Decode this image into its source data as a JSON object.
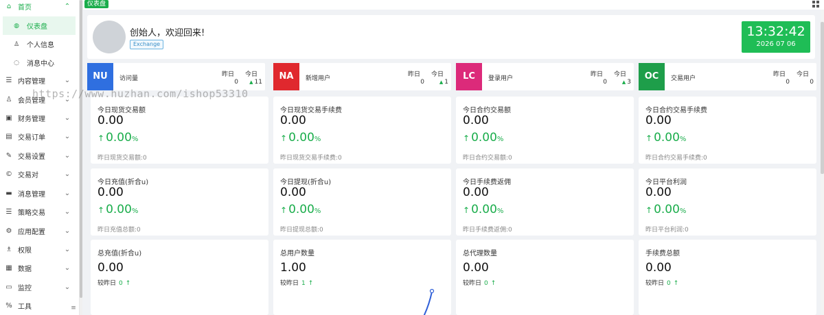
{
  "sidebar": {
    "items": [
      {
        "label": "首页",
        "icon": "home-icon",
        "glyph": "⌂",
        "chev": "⌃"
      },
      {
        "label": "内容管理",
        "icon": "list-icon",
        "glyph": "☰",
        "chev": "⌄"
      },
      {
        "label": "会员管理",
        "icon": "user-icon",
        "glyph": "♙",
        "chev": "⌄"
      },
      {
        "label": "财务管理",
        "icon": "finance-icon",
        "glyph": "▣",
        "chev": "⌄"
      },
      {
        "label": "交易订单",
        "icon": "order-icon",
        "glyph": "▤",
        "chev": "⌄"
      },
      {
        "label": "交易设置",
        "icon": "tool-icon",
        "glyph": "✎",
        "chev": "⌄"
      },
      {
        "label": "交易对",
        "icon": "copyright-icon",
        "glyph": "©",
        "chev": "⌄"
      },
      {
        "label": "消息管理",
        "icon": "message-icon",
        "glyph": "▬",
        "chev": "⌄"
      },
      {
        "label": "策略交易",
        "icon": "menu-icon",
        "glyph": "☰",
        "chev": "⌄"
      },
      {
        "label": "应用配置",
        "icon": "app-icon",
        "glyph": "⚙",
        "chev": "⌄"
      },
      {
        "label": "权限",
        "icon": "permission-icon",
        "glyph": "♗",
        "chev": "⌄"
      },
      {
        "label": "数据",
        "icon": "data-icon",
        "glyph": "▦",
        "chev": "⌄"
      },
      {
        "label": "监控",
        "icon": "monitor-icon",
        "glyph": "▭",
        "chev": "⌄"
      },
      {
        "label": "工具",
        "icon": "tools-icon",
        "glyph": "%",
        "chev": "⌄"
      }
    ],
    "sub_items": [
      {
        "label": "仪表盘",
        "icon": "dashboard-icon",
        "glyph": "◍"
      },
      {
        "label": "个人信息",
        "icon": "profile-icon",
        "glyph": "♙"
      },
      {
        "label": "消息中心",
        "icon": "message-center-icon",
        "glyph": "◌"
      }
    ],
    "collapse_glyph": "≡"
  },
  "topbar": {
    "tag": "仪表盘"
  },
  "welcome": {
    "greeting": "创始人，欢迎回来!",
    "badge": "Exchange",
    "time": "13:32:42",
    "date": "2026 07 06"
  },
  "stats": [
    {
      "code": "NU",
      "name": "访问量",
      "yesterday_label": "昨日",
      "yesterday": "0",
      "today_label": "今日",
      "today": "11",
      "color": "#2f6fe0"
    },
    {
      "code": "NA",
      "name": "新增用户",
      "yesterday_label": "昨日",
      "yesterday": "0",
      "today_label": "今日",
      "today": "1",
      "color": "#e0282e"
    },
    {
      "code": "LC",
      "name": "登录用户",
      "yesterday_label": "昨日",
      "yesterday": "0",
      "today_label": "今日",
      "today": "3",
      "color": "#dc2a7a"
    },
    {
      "code": "OC",
      "name": "交易用户",
      "yesterday_label": "昨日",
      "yesterday": "0",
      "today_label": "今日",
      "today": "0",
      "color": "#1e9e4a"
    }
  ],
  "cards_row1": [
    {
      "title": "今日现货交易额",
      "value": "0.00",
      "pct": "0.00",
      "unit": "%",
      "foot": "昨日现货交易额:0"
    },
    {
      "title": "今日现货交易手续费",
      "value": "0.00",
      "pct": "0.00",
      "unit": "%",
      "foot": "昨日现货交易手续费:0"
    },
    {
      "title": "今日合约交易额",
      "value": "0.00",
      "pct": "0.00",
      "unit": "%",
      "foot": "昨日合约交易额:0"
    },
    {
      "title": "今日合约交易手续费",
      "value": "0.00",
      "pct": "0.00",
      "unit": "%",
      "foot": "昨日合约交易手续费:0"
    }
  ],
  "cards_row2": [
    {
      "title": "今日充值(折合u)",
      "value": "0.00",
      "pct": "0.00",
      "unit": "%",
      "foot": "昨日充值总额:0"
    },
    {
      "title": "今日提现(折合u)",
      "value": "0.00",
      "pct": "0.00",
      "unit": "%",
      "foot": "昨日提现总额:0"
    },
    {
      "title": "今日手续费返佣",
      "value": "0.00",
      "pct": "0.00",
      "unit": "%",
      "foot": "昨日手续费返佣:0"
    },
    {
      "title": "今日平台利润",
      "value": "0.00",
      "pct": "0.00",
      "unit": "%",
      "foot": "昨日平台利润:0"
    }
  ],
  "cards_row3": [
    {
      "title": "总充值(折合u)",
      "value": "0.00",
      "cmp_label": "较昨日",
      "cmp_value": "0"
    },
    {
      "title": "总用户数量",
      "value": "1.00",
      "cmp_label": "较昨日",
      "cmp_value": "1"
    },
    {
      "title": "总代理数量",
      "value": "0.00",
      "cmp_label": "较昨日",
      "cmp_value": "0"
    },
    {
      "title": "手续费总额",
      "value": "0.00",
      "cmp_label": "较昨日",
      "cmp_value": "0"
    }
  ],
  "watermark": "https://www.huzhan.com/ishop53310",
  "colors": {
    "accent": "#1aad4b",
    "clock_bg": "#1fbd56"
  }
}
